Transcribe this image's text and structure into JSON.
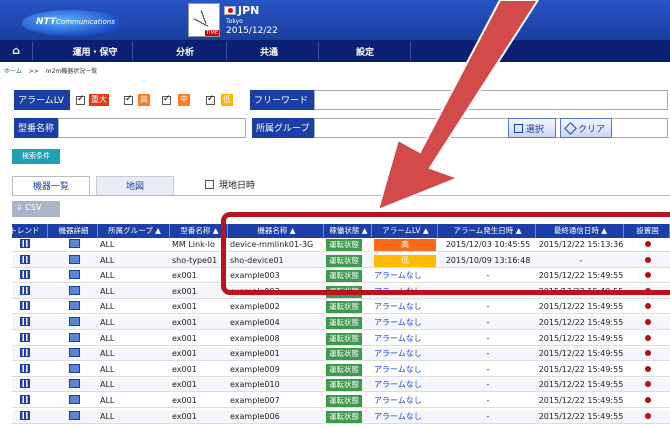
{
  "header": {
    "logo_bold": "NTT",
    "logo_rest": "Communications",
    "clock_label": "TIME",
    "country": "JPN",
    "city": "Tokyo",
    "date": "2015/12/22"
  },
  "nav": {
    "home": "⌂",
    "ops": "運用・保守",
    "analysis": "分析",
    "common": "共通",
    "settings": "設定"
  },
  "breadcrumb": {
    "home": "ホーム",
    "sep": ">>",
    "current": "m2m機器状況一覧"
  },
  "filters": {
    "alarm_lv_label": "アラームLV",
    "sev_critical": "重大",
    "sev_high": "高",
    "sev_mid": "中",
    "sev_low": "低",
    "freeword_label": "フリーワード",
    "model_label": "型番名称",
    "group_label": "所属グループ",
    "select_button": "選択",
    "clear_button": "クリア",
    "search_cond_button": "検索条件"
  },
  "tabs": {
    "list": "機器一覧",
    "map": "地図",
    "show_local_time": "現地日時",
    "csv_button": "CSV"
  },
  "colors": {
    "header_blue": "#1b3fa6",
    "op_green": "#3c9a4a",
    "alarm_high": "#ff6a1a",
    "alarm_low": "#ffbb00",
    "highlight_red": "#b8141e"
  },
  "table": {
    "headers": [
      "トレンド",
      "機器詳細",
      "所属グループ ▲",
      "型番名称 ▲",
      "機器名称 ▲",
      "稼働状態 ▲",
      "アラームLV ▲",
      "アラーム発生日時 ▲",
      "最終通信日時 ▲",
      "設置国"
    ],
    "rows": [
      {
        "group": "ALL",
        "model": "MM Link-Io",
        "device": "device-mmlink01-3G",
        "op": "運転状態",
        "alarm": "高",
        "alarm_type": "red",
        "alarm_time": "2015/12/03 10:45:55",
        "last": "2015/12/22 15:13:36"
      },
      {
        "group": "ALL",
        "model": "sho-type01",
        "device": "sho-device01",
        "op": "運転状態",
        "alarm": "低",
        "alarm_type": "yellow",
        "alarm_time": "2015/10/09 13:16:48",
        "last": "-"
      },
      {
        "group": "ALL",
        "model": "ex001",
        "device": "example003",
        "op": "運転状態",
        "alarm": "アラームなし",
        "alarm_type": "none",
        "alarm_time": "-",
        "last": "2015/12/22 15:49:55"
      },
      {
        "group": "ALL",
        "model": "ex001",
        "device": "example003",
        "op": "運転状態",
        "alarm": "アラームなし",
        "alarm_type": "none",
        "alarm_time": "-",
        "last": "2015/12/22 15:49:55"
      },
      {
        "group": "ALL",
        "model": "ex001",
        "device": "example002",
        "op": "運転状態",
        "alarm": "アラームなし",
        "alarm_type": "none",
        "alarm_time": "-",
        "last": "2015/12/22 15:49:55"
      },
      {
        "group": "ALL",
        "model": "ex001",
        "device": "example004",
        "op": "運転状態",
        "alarm": "アラームなし",
        "alarm_type": "none",
        "alarm_time": "-",
        "last": "2015/12/22 15:49:55"
      },
      {
        "group": "ALL",
        "model": "ex001",
        "device": "example008",
        "op": "運転状態",
        "alarm": "アラームなし",
        "alarm_type": "none",
        "alarm_time": "-",
        "last": "2015/12/22 15:49:55"
      },
      {
        "group": "ALL",
        "model": "ex001",
        "device": "example001",
        "op": "運転状態",
        "alarm": "アラームなし",
        "alarm_type": "none",
        "alarm_time": "-",
        "last": "2015/12/22 15:49:55"
      },
      {
        "group": "ALL",
        "model": "ex001",
        "device": "example009",
        "op": "運転状態",
        "alarm": "アラームなし",
        "alarm_type": "none",
        "alarm_time": "-",
        "last": "2015/12/22 15:49:55"
      },
      {
        "group": "ALL",
        "model": "ex001",
        "device": "example010",
        "op": "運転状態",
        "alarm": "アラームなし",
        "alarm_type": "none",
        "alarm_time": "-",
        "last": "2015/12/22 15:49:55"
      },
      {
        "group": "ALL",
        "model": "ex001",
        "device": "example007",
        "op": "運転状態",
        "alarm": "アラームなし",
        "alarm_type": "none",
        "alarm_time": "-",
        "last": "2015/12/22 15:49:55"
      },
      {
        "group": "ALL",
        "model": "ex001",
        "device": "example006",
        "op": "運転状態",
        "alarm": "アラームなし",
        "alarm_type": "none",
        "alarm_time": "-",
        "last": "2015/12/22 15:49:55"
      }
    ]
  }
}
